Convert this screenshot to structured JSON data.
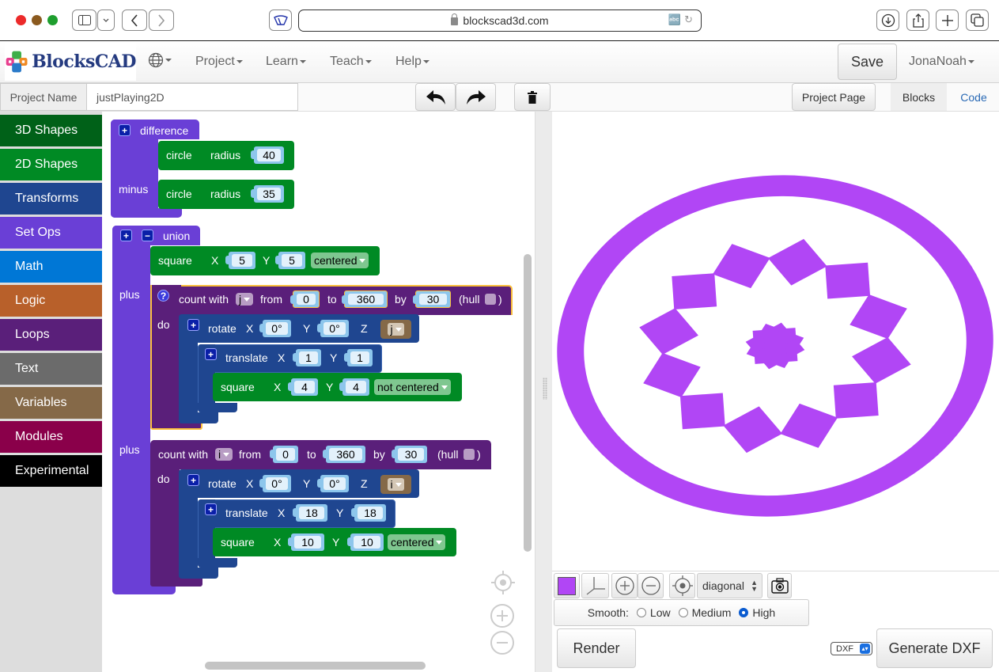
{
  "browser": {
    "url": "blockscad3d.com",
    "traffic_colors": [
      "#ec2a2a",
      "#8b5a1f",
      "#1e9e2e"
    ]
  },
  "navbar": {
    "logo_text": "BlocksCAD",
    "menus": [
      {
        "label": "Project"
      },
      {
        "label": "Learn"
      },
      {
        "label": "Teach"
      },
      {
        "label": "Help"
      }
    ],
    "save_label": "Save",
    "user_label": "JonaNoah"
  },
  "project_bar": {
    "name_label": "Project Name",
    "name_value": "justPlaying2D",
    "project_page_label": "Project Page",
    "blocks_tab_label": "Blocks",
    "code_tab_label": "Code"
  },
  "toolbox": {
    "categories": [
      {
        "label": "3D Shapes",
        "color": "#006118"
      },
      {
        "label": "2D Shapes",
        "color": "#008a24"
      },
      {
        "label": "Transforms",
        "color": "#1f4690"
      },
      {
        "label": "Set Ops",
        "color": "#6a3fd6"
      },
      {
        "label": "Math",
        "color": "#0077d6"
      },
      {
        "label": "Logic",
        "color": "#b8602a"
      },
      {
        "label": "Loops",
        "color": "#5a1f7a"
      },
      {
        "label": "Text",
        "color": "#6b6b6b"
      },
      {
        "label": "Variables",
        "color": "#856948"
      },
      {
        "label": "Modules",
        "color": "#8a004a"
      },
      {
        "label": "Experimental",
        "color": "#000000"
      }
    ]
  },
  "blocks": {
    "difference": {
      "label": "difference",
      "minus_label": "minus",
      "circle1": {
        "label": "circle",
        "radius_label": "radius",
        "radius": "40"
      },
      "circle2": {
        "label": "circle",
        "radius_label": "radius",
        "radius": "35"
      }
    },
    "union": {
      "label": "union",
      "plus_label": "plus",
      "do_label": "do",
      "square": {
        "label": "square",
        "x_label": "X",
        "y_label": "Y",
        "x": "5",
        "y": "5",
        "mode": "centered"
      },
      "loop1": {
        "count_label": "count with",
        "var": "j",
        "from_label": "from",
        "from": "0",
        "to_label": "to",
        "to": "360",
        "by_label": "by",
        "by": "30",
        "hull_label": "(hull",
        "hull_close": ")",
        "rotate": {
          "label": "rotate",
          "x": "0°",
          "y": "0°",
          "z_var": "j"
        },
        "translate": {
          "label": "translate",
          "x": "1",
          "y": "1"
        },
        "square": {
          "label": "square",
          "x": "4",
          "y": "4",
          "mode": "not centered"
        }
      },
      "loop2": {
        "count_label": "count with",
        "var": "i",
        "from_label": "from",
        "from": "0",
        "to_label": "to",
        "to": "360",
        "by_label": "by",
        "by": "30",
        "hull_label": "(hull",
        "hull_close": ")",
        "rotate": {
          "label": "rotate",
          "x": "0°",
          "y": "0°",
          "z_var": "i"
        },
        "translate": {
          "label": "translate",
          "x": "18",
          "y": "18"
        },
        "square": {
          "label": "square",
          "x": "10",
          "y": "10",
          "mode": "centered"
        }
      }
    },
    "axis_labels": {
      "x": "X",
      "y": "Y",
      "z": "Z"
    }
  },
  "viewer": {
    "shape_color": "#b146f5",
    "view_select": "diagonal",
    "smooth_label": "Smooth:",
    "smooth_options": [
      "Low",
      "Medium",
      "High"
    ],
    "smooth_selected": "High",
    "render_label": "Render",
    "format_select": "DXF",
    "generate_label": "Generate DXF"
  }
}
